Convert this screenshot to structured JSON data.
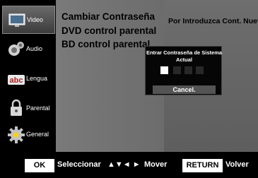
{
  "sidebar": {
    "items": [
      {
        "label": "Video",
        "icon": "monitor-icon",
        "active": true
      },
      {
        "label": "Audio",
        "icon": "speaker-icon",
        "active": false
      },
      {
        "label": "Lengua",
        "icon": "language-abc-icon",
        "active": false
      },
      {
        "label": "Parental",
        "icon": "parental-lock-icon",
        "active": false
      },
      {
        "label": "General",
        "icon": "gear-icon",
        "active": false
      }
    ]
  },
  "menu": {
    "items": [
      {
        "label": "Cambiar Contraseña"
      },
      {
        "label": "DVD control parental"
      },
      {
        "label": "BD control parental"
      }
    ]
  },
  "right_panel": {
    "title": "Por Introduzca Cont. Nueva"
  },
  "dialog": {
    "title_line1": "Entrar Contraseña de Sistema",
    "title_line2": "Actual",
    "pin_boxes": [
      {
        "state": "empty"
      },
      {
        "state": "filled"
      },
      {
        "state": "filled"
      },
      {
        "state": "filled"
      }
    ],
    "cancel_label": "Cancel."
  },
  "footer": {
    "ok_label": "OK",
    "select_label": "Seleccionar",
    "arrows": "▲▼◄ ►",
    "move_label": "Mover",
    "return_label": "RETURN",
    "back_label": "Volver"
  },
  "colors": {
    "accent": "#ffffff",
    "panel": "#6e6e6e",
    "background": "#000000"
  }
}
